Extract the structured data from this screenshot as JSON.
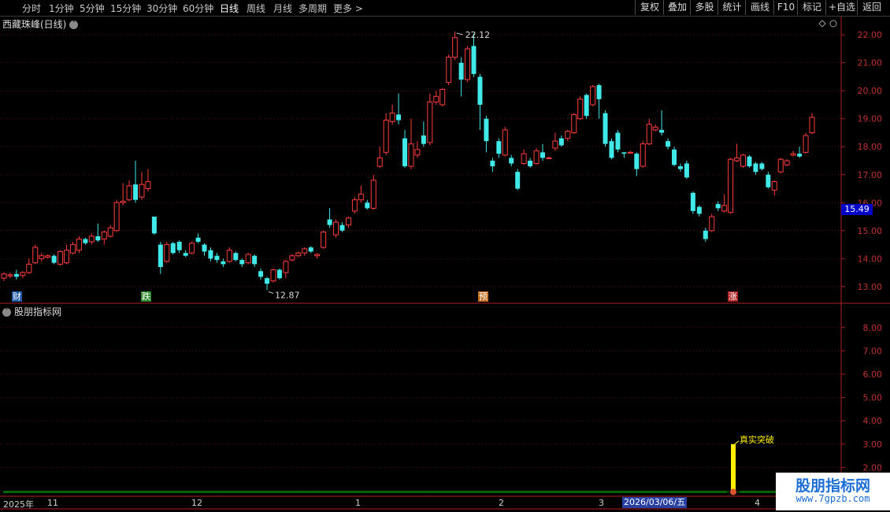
{
  "toolbar": {
    "periods": [
      "分时",
      "1分钟",
      "5分钟",
      "15分钟",
      "30分钟",
      "60分钟",
      "日线",
      "周线",
      "月线",
      "多周期",
      "更多"
    ],
    "active_period": "日线",
    "buttons": [
      "复权",
      "叠加",
      "多股",
      "统计",
      "画线",
      "F10",
      "标记",
      "+自选",
      "返回"
    ]
  },
  "main_chart": {
    "title": "西藏珠峰(日线)",
    "current_price": "15.49",
    "high_label": "22.12",
    "low_label": "12.87",
    "event_tags": [
      {
        "text": "财",
        "color": "#1e5aa8"
      },
      {
        "text": "跌",
        "color": "#2e8b2e"
      },
      {
        "text": "预",
        "color": "#c07020"
      },
      {
        "text": "涨",
        "color": "#b02020"
      }
    ]
  },
  "indicator_panel": {
    "title": "股朋指标网",
    "signal_label": "真实突破"
  },
  "time_axis": {
    "labels": [
      "2025年",
      "11",
      "12",
      "1",
      "2",
      "3",
      "4"
    ],
    "cursor_date": "2026/03/06/五"
  },
  "watermark": {
    "title": "股朋指标网",
    "url": "www.7gpzb.com"
  },
  "chart_data": [
    {
      "type": "candlestick",
      "title": "西藏珠峰(日线)",
      "ylim": [
        12.6,
        22.4
      ],
      "y_ticks": [
        13.0,
        14.0,
        15.0,
        16.0,
        17.0,
        18.0,
        19.0,
        20.0,
        21.0,
        22.0
      ],
      "candles": [
        [
          13.3,
          13.45,
          13.2,
          13.5
        ],
        [
          13.38,
          13.42,
          13.3,
          13.5
        ],
        [
          13.45,
          13.35,
          13.25,
          13.6
        ],
        [
          13.4,
          13.5,
          13.3,
          13.55
        ],
        [
          13.5,
          13.8,
          13.45,
          14.0
        ],
        [
          13.85,
          14.4,
          13.8,
          14.5
        ],
        [
          14.0,
          14.1,
          13.9,
          14.2
        ],
        [
          14.05,
          14.1,
          14.0,
          14.15
        ],
        [
          14.1,
          13.85,
          13.8,
          14.15
        ],
        [
          13.8,
          14.25,
          13.75,
          14.3
        ],
        [
          13.85,
          14.3,
          13.8,
          14.5
        ],
        [
          14.2,
          14.5,
          14.15,
          14.6
        ],
        [
          14.3,
          14.7,
          14.2,
          14.8
        ],
        [
          14.7,
          14.55,
          14.5,
          14.75
        ],
        [
          14.6,
          14.8,
          14.5,
          14.9
        ],
        [
          14.8,
          14.65,
          14.6,
          15.25
        ],
        [
          14.7,
          14.95,
          14.5,
          15.0
        ],
        [
          14.8,
          15.1,
          14.75,
          15.2
        ],
        [
          15.0,
          16.0,
          14.95,
          16.1
        ],
        [
          16.0,
          16.05,
          15.9,
          16.7
        ],
        [
          16.1,
          16.6,
          16.05,
          16.8
        ],
        [
          16.65,
          16.1,
          16.0,
          17.5
        ],
        [
          16.2,
          16.65,
          16.1,
          17.1
        ],
        [
          16.5,
          16.75,
          16.4,
          17.2
        ],
        [
          15.5,
          14.9,
          14.85,
          15.5
        ],
        [
          14.5,
          13.7,
          13.45,
          14.6
        ],
        [
          13.9,
          14.5,
          13.85,
          14.6
        ],
        [
          14.55,
          14.2,
          14.15,
          14.6
        ],
        [
          14.6,
          14.3,
          14.2,
          14.65
        ],
        [
          14.2,
          14.1,
          14.05,
          14.3
        ],
        [
          14.2,
          14.55,
          14.15,
          14.6
        ],
        [
          14.75,
          14.6,
          14.55,
          14.9
        ],
        [
          14.5,
          14.25,
          14.1,
          14.55
        ],
        [
          14.3,
          14.0,
          13.9,
          14.4
        ],
        [
          14.1,
          13.95,
          13.85,
          14.2
        ],
        [
          13.9,
          13.8,
          13.7,
          14.0
        ],
        [
          13.9,
          14.3,
          13.85,
          14.4
        ],
        [
          14.2,
          13.95,
          13.9,
          14.25
        ],
        [
          13.95,
          13.8,
          13.7,
          14.0
        ],
        [
          13.85,
          14.15,
          13.8,
          14.2
        ],
        [
          14.1,
          13.8,
          13.7,
          14.15
        ],
        [
          13.55,
          13.35,
          13.25,
          13.65
        ],
        [
          13.3,
          13.1,
          12.87,
          13.35
        ],
        [
          13.2,
          13.6,
          13.15,
          13.65
        ],
        [
          13.6,
          13.3,
          13.25,
          13.65
        ],
        [
          13.5,
          13.9,
          13.3,
          13.95
        ],
        [
          13.95,
          14.1,
          13.9,
          14.15
        ],
        [
          14.1,
          14.2,
          14.05,
          14.25
        ],
        [
          14.2,
          14.35,
          14.1,
          14.4
        ],
        [
          14.4,
          14.25,
          14.2,
          14.45
        ],
        [
          14.1,
          14.15,
          14.0,
          14.2
        ],
        [
          14.4,
          14.95,
          14.35,
          15.0
        ],
        [
          15.4,
          15.2,
          15.1,
          15.8
        ],
        [
          14.85,
          15.3,
          14.75,
          15.4
        ],
        [
          15.2,
          15.0,
          14.95,
          15.3
        ],
        [
          15.2,
          15.45,
          15.1,
          15.5
        ],
        [
          15.7,
          16.1,
          15.6,
          16.2
        ],
        [
          16.1,
          16.3,
          16.0,
          16.6
        ],
        [
          16.0,
          15.8,
          15.75,
          16.1
        ],
        [
          15.8,
          16.8,
          15.75,
          17.0
        ],
        [
          17.3,
          17.6,
          17.25,
          18.0
        ],
        [
          17.8,
          18.95,
          17.7,
          19.2
        ],
        [
          18.9,
          19.2,
          18.8,
          19.5
        ],
        [
          19.15,
          18.95,
          18.8,
          19.9
        ],
        [
          18.3,
          17.3,
          17.25,
          18.6
        ],
        [
          17.3,
          18.1,
          17.2,
          19.0
        ],
        [
          17.7,
          17.9,
          17.6,
          18.2
        ],
        [
          18.4,
          18.1,
          18.0,
          18.9
        ],
        [
          18.15,
          19.6,
          18.05,
          19.9
        ],
        [
          19.6,
          19.8,
          19.5,
          20.0
        ],
        [
          19.5,
          20.05,
          19.45,
          20.1
        ],
        [
          20.3,
          21.2,
          20.2,
          21.3
        ],
        [
          21.2,
          21.9,
          21.1,
          22.12
        ],
        [
          21.0,
          20.4,
          19.8,
          21.2
        ],
        [
          20.4,
          21.5,
          20.3,
          21.6
        ],
        [
          21.6,
          20.6,
          20.5,
          22.05
        ],
        [
          20.5,
          19.5,
          18.6,
          20.6
        ],
        [
          19.0,
          18.2,
          17.8,
          19.1
        ],
        [
          17.5,
          17.3,
          17.1,
          17.6
        ],
        [
          18.2,
          17.75,
          17.6,
          18.3
        ],
        [
          17.7,
          18.6,
          17.65,
          18.7
        ],
        [
          17.6,
          17.4,
          17.3,
          17.7
        ],
        [
          17.1,
          16.5,
          16.45,
          17.2
        ],
        [
          17.4,
          17.75,
          17.35,
          17.9
        ],
        [
          17.5,
          17.3,
          17.25,
          17.6
        ],
        [
          17.4,
          17.85,
          17.35,
          17.95
        ],
        [
          17.8,
          17.6,
          17.5,
          18.1
        ],
        [
          17.6,
          17.6,
          17.55,
          17.65
        ],
        [
          17.95,
          18.2,
          17.85,
          18.5
        ],
        [
          18.3,
          18.05,
          18.0,
          18.4
        ],
        [
          18.3,
          18.55,
          18.2,
          18.6
        ],
        [
          18.5,
          19.15,
          18.45,
          19.2
        ],
        [
          19.0,
          19.7,
          18.95,
          19.8
        ],
        [
          19.85,
          19.1,
          19.0,
          19.9
        ],
        [
          19.5,
          20.15,
          19.45,
          20.2
        ],
        [
          20.2,
          19.7,
          19.0,
          20.25
        ],
        [
          19.2,
          18.1,
          18.0,
          19.3
        ],
        [
          18.2,
          17.6,
          17.55,
          18.3
        ],
        [
          18.5,
          17.9,
          17.8,
          18.6
        ],
        [
          17.8,
          17.75,
          17.6,
          17.8
        ],
        [
          17.8,
          17.8,
          17.75,
          17.85
        ],
        [
          17.75,
          17.2,
          16.95,
          17.8
        ],
        [
          17.3,
          18.1,
          17.25,
          18.2
        ],
        [
          18.1,
          18.8,
          18.05,
          19.0
        ],
        [
          18.6,
          18.7,
          18.55,
          18.8
        ],
        [
          18.6,
          18.5,
          18.4,
          19.3
        ],
        [
          18.2,
          18.0,
          17.9,
          18.3
        ],
        [
          17.9,
          17.35,
          17.3,
          18.0
        ],
        [
          17.3,
          17.2,
          17.1,
          17.4
        ],
        [
          17.4,
          16.9,
          16.85,
          17.5
        ],
        [
          16.35,
          15.7,
          15.6,
          16.4
        ],
        [
          15.85,
          15.6,
          15.5,
          15.9
        ],
        [
          15.0,
          14.7,
          14.6,
          15.1
        ],
        [
          15.0,
          15.5,
          14.95,
          15.6
        ],
        [
          15.95,
          15.8,
          15.7,
          16.05
        ],
        [
          15.7,
          15.9,
          15.65,
          16.3
        ],
        [
          15.65,
          17.55,
          15.6,
          17.6
        ],
        [
          17.5,
          17.6,
          17.45,
          18.1
        ],
        [
          17.3,
          17.7,
          17.25,
          17.75
        ],
        [
          17.65,
          17.3,
          17.25,
          17.7
        ],
        [
          17.4,
          17.1,
          17.0,
          17.45
        ],
        [
          17.4,
          17.2,
          17.15,
          17.45
        ],
        [
          17.0,
          16.55,
          16.5,
          17.1
        ],
        [
          16.45,
          16.75,
          16.25,
          16.8
        ],
        [
          17.1,
          17.55,
          17.05,
          17.6
        ],
        [
          17.35,
          17.5,
          17.3,
          17.55
        ],
        [
          17.7,
          17.75,
          17.65,
          17.85
        ],
        [
          17.75,
          17.65,
          17.6,
          18.0
        ],
        [
          17.8,
          18.4,
          17.75,
          18.5
        ],
        [
          18.5,
          19.05,
          18.45,
          19.2
        ]
      ]
    },
    {
      "type": "bar",
      "title": "股朋指标网",
      "ylim": [
        0.9,
        8.6
      ],
      "y_ticks": [
        1.0,
        2.0,
        3.0,
        4.0,
        5.0,
        6.0,
        7.0,
        8.0
      ],
      "band_level": 1.0,
      "band_color": "#006400",
      "signal": {
        "value": 3.0,
        "label": "真实突破",
        "color": "#ffee00"
      }
    }
  ]
}
